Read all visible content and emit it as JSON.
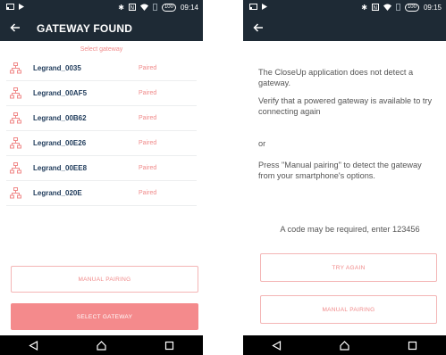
{
  "left_screen": {
    "status_bar": {
      "icons": [
        "cast-icon",
        "play-store-icon",
        "bluetooth-icon",
        "nfc-icon",
        "wifi-icon",
        "sim-icon"
      ],
      "battery": "100",
      "time": "09:14"
    },
    "app_bar": {
      "back_icon": "arrow-left-icon",
      "title": "GATEWAY FOUND"
    },
    "section_label": "Select gateway",
    "gateways": [
      {
        "name": "Legrand_0035",
        "status": "Paired",
        "icon": "network-hub-icon"
      },
      {
        "name": "Legrand_00AF5",
        "status": "Paired",
        "icon": "network-hub-icon"
      },
      {
        "name": "Legrand_00B62",
        "status": "Paired",
        "icon": "network-hub-icon"
      },
      {
        "name": "Legrand_00E26",
        "status": "Paired",
        "icon": "network-hub-icon"
      },
      {
        "name": "Legrand_00EE8",
        "status": "Paired",
        "icon": "network-hub-icon"
      },
      {
        "name": "Legrand_020E",
        "status": "Paired",
        "icon": "network-hub-icon"
      }
    ],
    "manual_pairing_label": "MANUAL PAIRING",
    "select_gateway_label": "SELECT GATEWAY"
  },
  "right_screen": {
    "status_bar": {
      "icons": [
        "cast-icon",
        "play-store-icon",
        "bluetooth-icon",
        "nfc-icon",
        "wifi-icon",
        "sim-icon"
      ],
      "battery": "100",
      "time": "09:15"
    },
    "app_bar": {
      "back_icon": "arrow-left-icon"
    },
    "message_1": "The CloseUp application does not detect a gateway.",
    "message_2": "Verify that a powered gateway is available to try connecting again",
    "message_or": "or",
    "message_3": "Press \"Manual pairing\" to detect the gateway from your smartphone's options.",
    "code_hint": "A code may be required, enter 123456",
    "try_again_label": "TRY AGAIN",
    "manual_pairing_label": "MANUAL PAIRING"
  },
  "nav_bar": {
    "icons": [
      "back-triangle-icon",
      "home-icon",
      "recents-icon"
    ]
  },
  "colors": {
    "header": "#1e2a35",
    "accent": "#f48a8c",
    "accent_text": "#f08a8a",
    "gateway_name": "#1e3a5a",
    "nav": "#000000"
  }
}
